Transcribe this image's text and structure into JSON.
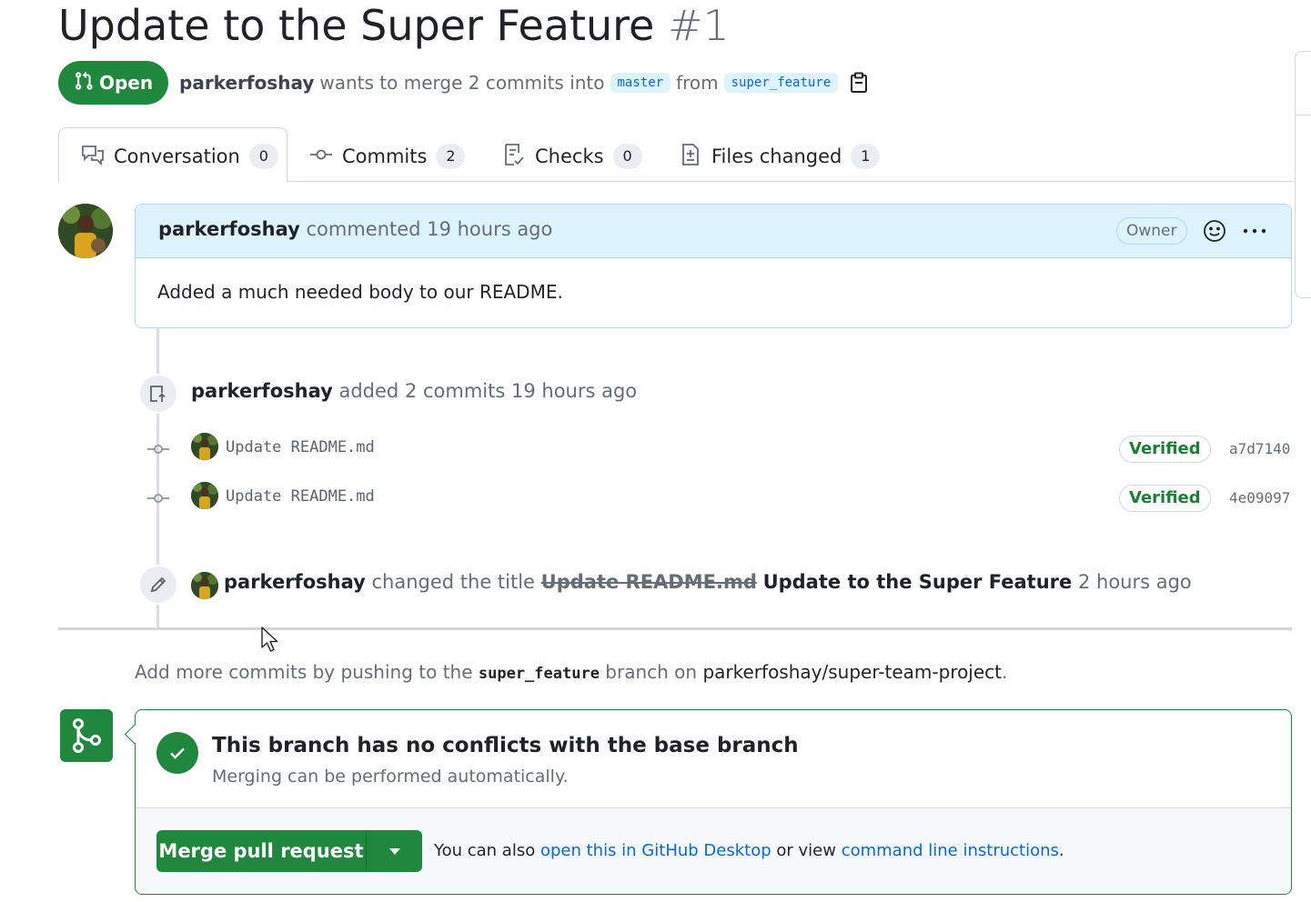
{
  "pr": {
    "title": "Update to the Super Feature",
    "number": "#1",
    "state": "Open",
    "author": "parkerfoshay",
    "merge_text": "wants to merge 2 commits into",
    "base_branch": "master",
    "from_text": "from",
    "head_branch": "super_feature"
  },
  "tabs": [
    {
      "label": "Conversation",
      "count": "0"
    },
    {
      "label": "Commits",
      "count": "2"
    },
    {
      "label": "Checks",
      "count": "0"
    },
    {
      "label": "Files changed",
      "count": "1"
    }
  ],
  "comment": {
    "author": "parkerfoshay",
    "action": "commented",
    "time": "19 hours ago",
    "badge": "Owner",
    "body": "Added a much needed body to our README."
  },
  "timeline": {
    "commits_event": {
      "author": "parkerfoshay",
      "action": "added 2 commits",
      "time": "19 hours ago"
    },
    "commits": [
      {
        "message": "Update README.md",
        "badge": "Verified",
        "sha": "a7d7140"
      },
      {
        "message": "Update README.md",
        "badge": "Verified",
        "sha": "4e09097"
      }
    ],
    "rename_event": {
      "author": "parkerfoshay",
      "action": "changed the title",
      "old_title": "Update README.md",
      "new_title": "Update to the Super Feature",
      "time": "2 hours ago"
    }
  },
  "push_hint": {
    "prefix": "Add more commits by pushing to the",
    "branch": "super_feature",
    "middle": "branch on",
    "repo": "parkerfoshay/super-team-project",
    "suffix": "."
  },
  "merge": {
    "title": "This branch has no conflicts with the base branch",
    "subtitle": "Merging can be performed automatically.",
    "button_label": "Merge pull request",
    "help_prefix": "You can also",
    "link_desktop": "open this in GitHub Desktop",
    "help_middle": "or view",
    "link_cli": "command line instructions",
    "help_suffix": "."
  },
  "colors": {
    "green": "#1f883d",
    "link_blue": "#0969da",
    "header_blue": "#ddf4ff",
    "verified_green": "#1a7f37"
  },
  "icons": [
    "git-pull-request-icon",
    "copy-icon",
    "comment-discussion-icon",
    "git-commit-icon",
    "checklist-icon",
    "file-diff-icon",
    "smiley-icon",
    "kebab-horizontal-icon",
    "repo-push-icon",
    "pencil-icon",
    "git-merge-icon",
    "check-icon",
    "triangle-down-icon",
    "mouse-cursor-icon"
  ]
}
